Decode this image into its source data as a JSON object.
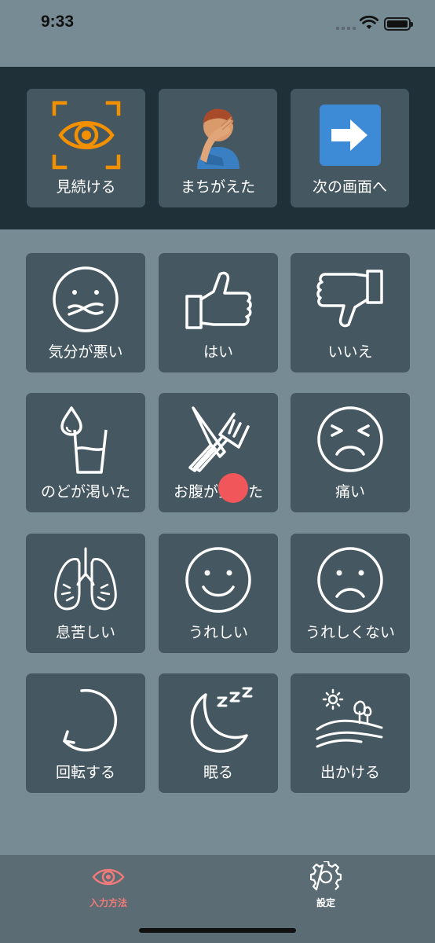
{
  "status_bar": {
    "time": "9:33"
  },
  "top_actions": [
    {
      "label": "見続ける",
      "icon": "eye-focus-icon"
    },
    {
      "label": "まちがえた",
      "icon": "facepalm-icon"
    },
    {
      "label": "次の画面へ",
      "icon": "arrow-right-icon"
    }
  ],
  "grid_items": [
    {
      "label": "気分が悪い",
      "icon": "sick-face-icon"
    },
    {
      "label": "はい",
      "icon": "thumbs-up-icon"
    },
    {
      "label": "いいえ",
      "icon": "thumbs-down-icon"
    },
    {
      "label": "のどが渇いた",
      "icon": "water-glass-icon"
    },
    {
      "label": "お腹が空いた",
      "icon": "fork-knife-icon"
    },
    {
      "label": "痛い",
      "icon": "pain-face-icon"
    },
    {
      "label": "息苦しい",
      "icon": "lungs-icon"
    },
    {
      "label": "うれしい",
      "icon": "smile-face-icon"
    },
    {
      "label": "うれしくない",
      "icon": "sad-face-icon"
    },
    {
      "label": "回転する",
      "icon": "rotate-icon"
    },
    {
      "label": "眠る",
      "icon": "sleep-moon-icon"
    },
    {
      "label": "出かける",
      "icon": "outing-landscape-icon"
    }
  ],
  "tab_bar": {
    "tabs": [
      {
        "label": "入力方法",
        "icon": "eye-icon",
        "active": true
      },
      {
        "label": "設定",
        "icon": "gear-icon",
        "active": false
      }
    ]
  },
  "colors": {
    "background": "#778b95",
    "band": "#203039",
    "tile": "#455760",
    "active_tab": "#f07a7a",
    "accent_orange": "#f29000",
    "accent_blue": "#3d8ad6",
    "touch_indicator": "#f0565a"
  }
}
